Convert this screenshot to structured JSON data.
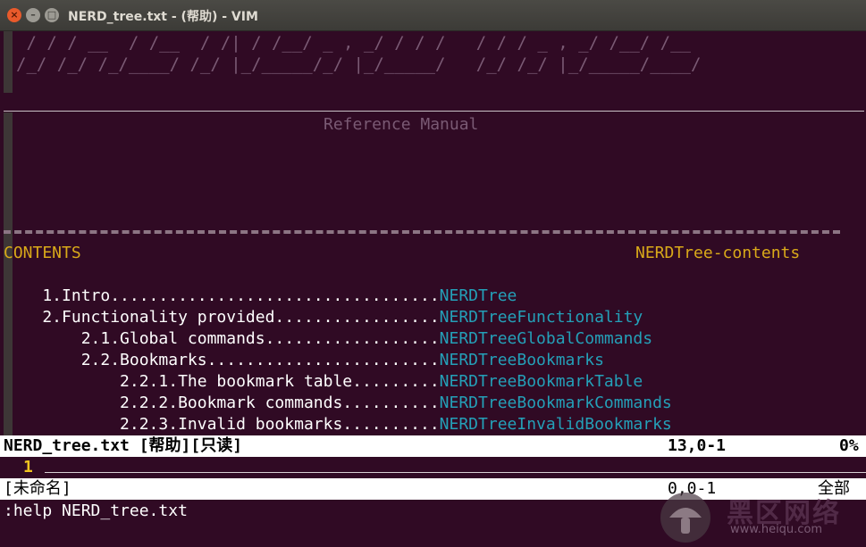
{
  "window": {
    "title": "NERD_tree.txt - (帮助) - VIM",
    "close_icon": "×",
    "min_icon": "–",
    "max_icon": "□"
  },
  "ascii_art": [
    " / / / __  / /__  / /| / /__/ _ , _/ / / /   / / / _ , _/ /__/ /__",
    "/_/ /_/ /_/____/ /_/ |_/_____/_/ |_/_____/   /_/ /_/ |_/_____/____/"
  ],
  "header": {
    "reference": "Reference Manual",
    "contents_label": "CONTENTS",
    "contents_tag": "NERDTree-contents"
  },
  "toc": [
    {
      "text": "    1.Intro..................................",
      "tag": "NERDTree"
    },
    {
      "text": "    2.Functionality provided.................",
      "tag": "NERDTreeFunctionality"
    },
    {
      "text": "        2.1.Global commands..................",
      "tag": "NERDTreeGlobalCommands"
    },
    {
      "text": "        2.2.Bookmarks........................",
      "tag": "NERDTreeBookmarks"
    },
    {
      "text": "            2.2.1.The bookmark table.........",
      "tag": "NERDTreeBookmarkTable"
    },
    {
      "text": "            2.2.2.Bookmark commands..........",
      "tag": "NERDTreeBookmarkCommands"
    },
    {
      "text": "            2.2.3.Invalid bookmarks..........",
      "tag": "NERDTreeInvalidBookmarks"
    }
  ],
  "status_help": {
    "file": "NERD_tree.txt [帮助][只读]",
    "position": "13,0-1",
    "percent": "0%"
  },
  "empty_buffer": {
    "line_number": "1"
  },
  "status_unnamed": {
    "file": "[未命名]",
    "position": "0,0-1",
    "percent": "全部"
  },
  "command_line": ":help NERD_tree.txt",
  "watermark": {
    "text": "黑区网络",
    "url": "www.heiqu.com"
  }
}
